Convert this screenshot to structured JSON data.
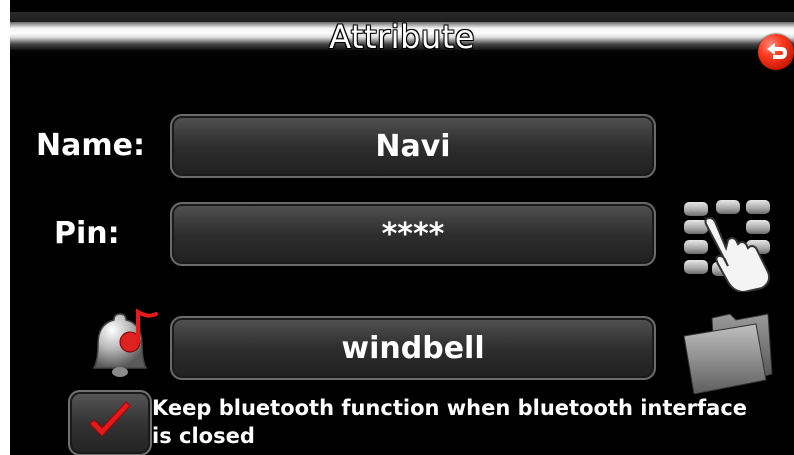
{
  "header": {
    "title": "Attribute"
  },
  "form": {
    "name_label": "Name:",
    "name_value": "Navi",
    "pin_label": "Pin:",
    "pin_value": "****",
    "ringtone_value": "windbell"
  },
  "options": {
    "keep_bluetooth_label": "Keep bluetooth function when bluetooth interface is closed",
    "keep_bluetooth_checked": true
  },
  "icons": {
    "back": "back-arrow-icon",
    "keypad": "keypad-icon",
    "ringtone": "bell-music-icon",
    "folder": "folder-icon",
    "checkmark": "checkmark-icon"
  },
  "colors": {
    "background": "#000000",
    "text": "#ffffff",
    "back_button": "#ff3a1e",
    "checkmark": "#e01b1b",
    "field": "#2e2e2e"
  }
}
